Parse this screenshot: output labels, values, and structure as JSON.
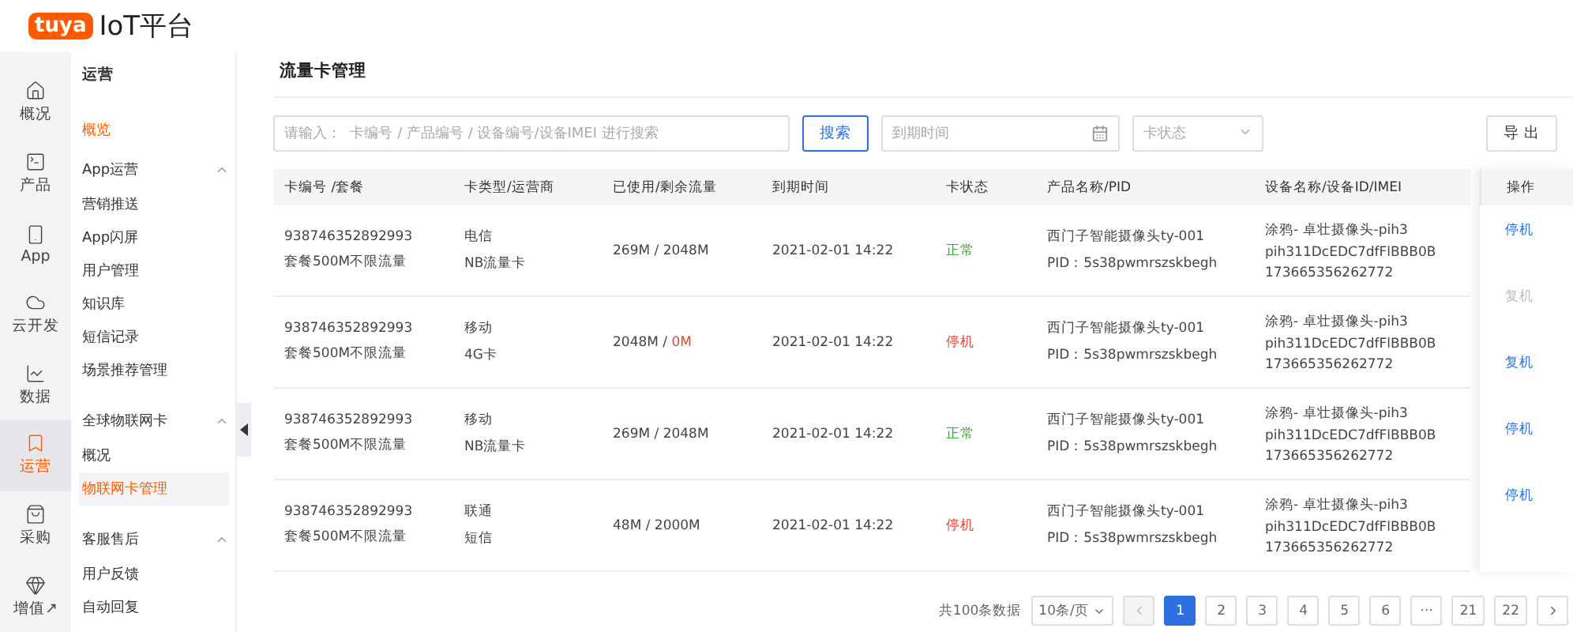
{
  "header": {
    "logo": "tuya",
    "title": "IoT平台"
  },
  "rail": [
    {
      "label": "概况",
      "selected": false
    },
    {
      "label": "产品",
      "selected": false
    },
    {
      "label": "App",
      "selected": false
    },
    {
      "label": "云开发",
      "selected": false
    },
    {
      "label": "数据",
      "selected": false
    },
    {
      "label": "运营",
      "selected": true
    },
    {
      "label": "采购",
      "selected": false
    },
    {
      "label": "增值↗",
      "selected": false
    }
  ],
  "submenu": {
    "title": "运营",
    "overview_link": "概览",
    "groups": [
      {
        "title": "App运营",
        "expanded": true,
        "items": [
          {
            "label": "营销推送",
            "selected": false
          },
          {
            "label": "App闪屏",
            "selected": false
          },
          {
            "label": "用户管理",
            "selected": false
          },
          {
            "label": "知识库",
            "selected": false
          },
          {
            "label": "短信记录",
            "selected": false
          },
          {
            "label": "场景推荐管理",
            "selected": false
          }
        ]
      },
      {
        "title": "全球物联网卡",
        "expanded": true,
        "items": [
          {
            "label": "概况",
            "selected": false
          },
          {
            "label": "物联网卡管理",
            "selected": true
          }
        ]
      },
      {
        "title": "客服售后",
        "expanded": true,
        "items": [
          {
            "label": "用户反馈",
            "selected": false
          },
          {
            "label": "自动回复",
            "selected": false
          }
        ]
      }
    ]
  },
  "page_title": "流量卡管理",
  "toolbar": {
    "search_placeholder": "请输入：  卡编号 / 产品编号 / 设备编号/设备IMEI 进行搜索",
    "search_button": "搜索",
    "date_placeholder": "到期时间",
    "status_placeholder": "卡状态",
    "export_button": "导 出"
  },
  "table": {
    "columns": [
      "卡编号 /套餐",
      "卡类型/运营商",
      "已使用/剩余流量",
      "到期时间",
      "卡状态",
      "产品名称/PID",
      "设备名称/设备ID/IMEI",
      "操作"
    ],
    "rows": [
      {
        "card_no": "938746352892993",
        "plan": "套餐500M不限流量",
        "carrier": "电信",
        "card_type": "NB流量卡",
        "used": "269M / ",
        "remaining": "2048M",
        "depleted": false,
        "expiry": "2021-02-01 14:22",
        "status": {
          "text": "正常",
          "kind": "normal"
        },
        "product": "西门子智能摄像头ty-001",
        "pid": "PID：5s38pwmrszskbegh",
        "device_name": "涂鸦- 卓壮摄像头-pih3",
        "device_id": "pih311DcEDC7dfFlBBB0B",
        "imei": "173665356262772"
      },
      {
        "card_no": "938746352892993",
        "plan": "套餐500M不限流量",
        "carrier": "移动",
        "card_type": "4G卡",
        "used": "2048M / ",
        "remaining": "0M",
        "depleted": true,
        "expiry": "2021-02-01 14:22",
        "status": {
          "text": "停机",
          "kind": "stopped"
        },
        "product": "西门子智能摄像头ty-001",
        "pid": "PID：5s38pwmrszskbegh",
        "device_name": "涂鸦- 卓壮摄像头-pih3",
        "device_id": "pih311DcEDC7dfFlBBB0B",
        "imei": "173665356262772"
      },
      {
        "card_no": "938746352892993",
        "plan": "套餐500M不限流量",
        "carrier": "移动",
        "card_type": "NB流量卡",
        "used": "269M / ",
        "remaining": "2048M",
        "depleted": false,
        "expiry": "2021-02-01 14:22",
        "status": {
          "text": "正常",
          "kind": "normal"
        },
        "product": "西门子智能摄像头ty-001",
        "pid": "PID：5s38pwmrszskbegh",
        "device_name": "涂鸦- 卓壮摄像头-pih3",
        "device_id": "pih311DcEDC7dfFlBBB0B",
        "imei": "173665356262772"
      },
      {
        "card_no": "938746352892993",
        "plan": "套餐500M不限流量",
        "carrier": "联通",
        "card_type": "短信",
        "used": "48M / ",
        "remaining": "2000M",
        "depleted": false,
        "expiry": "2021-02-01 14:22",
        "status": {
          "text": "停机",
          "kind": "stopped"
        },
        "product": "西门子智能摄像头ty-001",
        "pid": "PID：5s38pwmrszskbegh",
        "device_name": "涂鸦- 卓壮摄像头-pih3",
        "device_id": "pih311DcEDC7dfFlBBB0B",
        "imei": "173665356262772"
      }
    ],
    "actions": [
      {
        "label": "停机",
        "disabled": false
      },
      {
        "label": "复机",
        "disabled": true
      },
      {
        "label": "复机",
        "disabled": false
      },
      {
        "label": "停机",
        "disabled": false
      },
      {
        "label": "停机",
        "disabled": false
      }
    ]
  },
  "pagination": {
    "total": "共100条数据",
    "page_size": "10条/页",
    "prev_disabled": true,
    "pages": [
      {
        "label": "1",
        "selected": true
      },
      {
        "label": "2",
        "selected": false
      },
      {
        "label": "3",
        "selected": false
      },
      {
        "label": "4",
        "selected": false
      },
      {
        "label": "5",
        "selected": false
      },
      {
        "label": "6",
        "selected": false
      },
      {
        "label": "···",
        "selected": false
      },
      {
        "label": "21",
        "selected": false
      },
      {
        "label": "22",
        "selected": false
      }
    ]
  }
}
